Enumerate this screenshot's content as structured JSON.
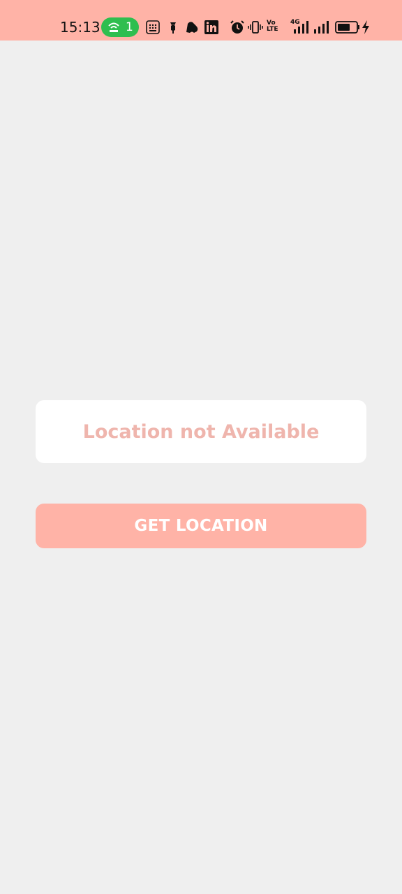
{
  "status_bar": {
    "time": "15:13",
    "hotspot_count": "1",
    "volte_label_top": "Vo",
    "volte_label_bottom": "LTE",
    "network_type": "4G",
    "colors": {
      "background": "#ffb3a7",
      "hotspot_pill": "#2fbe4f"
    },
    "icons": [
      "hotspot-icon",
      "calculator-icon",
      "notification-icon",
      "app-icon",
      "linkedin-icon",
      "alarm-icon",
      "vibrate-icon",
      "volte-icon",
      "signal-icon",
      "signal-icon",
      "battery-icon",
      "charging-icon"
    ]
  },
  "main": {
    "location_text": "Location not Available",
    "get_location_label": "GET LOCATION",
    "colors": {
      "background": "#efefef",
      "accent": "#ffb3a7",
      "location_text": "#efb5ad"
    }
  }
}
